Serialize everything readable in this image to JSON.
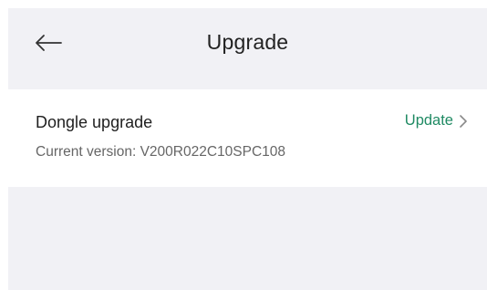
{
  "header": {
    "title": "Upgrade",
    "back_icon": "arrow-left-icon"
  },
  "dongle": {
    "title": "Dongle upgrade",
    "version_label": "Current version:",
    "version_value": "V200R022C10SPC108",
    "update_label": "Update",
    "chevron_icon": "chevron-right-icon"
  },
  "colors": {
    "background": "#f1f1f5",
    "card": "#ffffff",
    "accent": "#1f8a63"
  }
}
